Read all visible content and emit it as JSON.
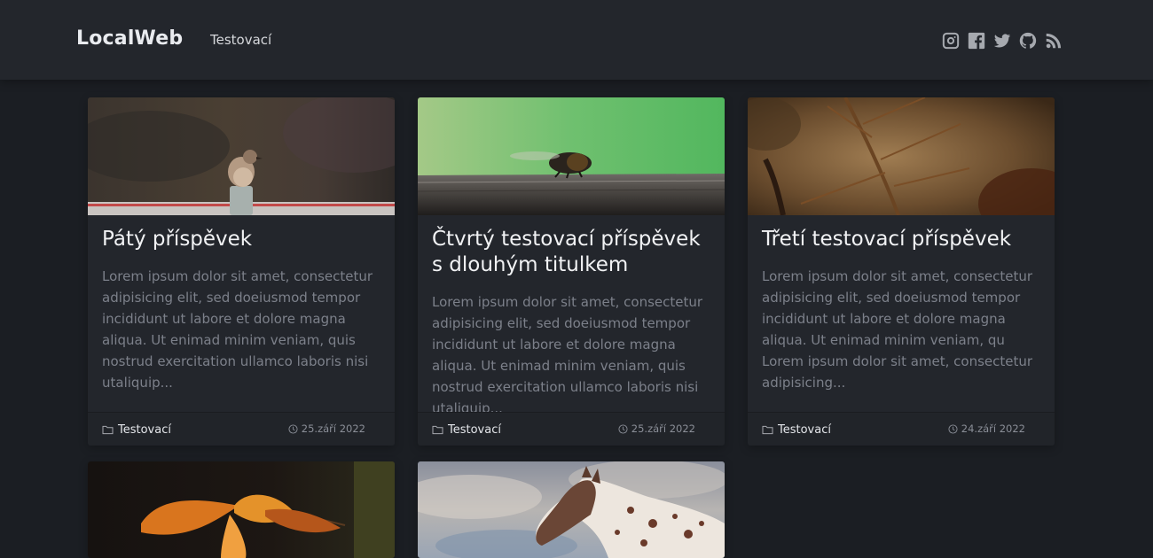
{
  "header": {
    "brand": "LocalWeb",
    "nav": [
      "Testovací"
    ],
    "social_icons": [
      "instagram-icon",
      "facebook-icon",
      "twitter-icon",
      "github-icon",
      "rss-icon"
    ]
  },
  "posts": [
    {
      "title": "Pátý příspěvek",
      "excerpt": "Lorem ipsum dolor sit amet, consectetur adipisicing elit, sed doeiusmod tempor incididunt ut labore et dolore magna aliqua. Ut enimad minim veniam, quis nostrud exercitation ullamco laboris nisi utaliquip...",
      "category": "Testovací",
      "date": "25.září 2022"
    },
    {
      "title": "Čtvrtý testovací příspěvek s dlouhým titulkem",
      "excerpt": "Lorem ipsum dolor sit amet, consectetur adipisicing elit, sed doeiusmod tempor incididunt ut labore et dolore magna aliqua. Ut enimad minim veniam, quis nostrud exercitation ullamco laboris nisi utaliquip...",
      "category": "Testovací",
      "date": "25.září 2022"
    },
    {
      "title": "Třetí testovací příspěvek",
      "excerpt": "Lorem ipsum dolor sit amet, consectetur adipisicing elit, sed doeiusmod tempor incididunt ut labore et dolore magna aliqua. Ut enimad minim veniam, qu Lorem ipsum dolor sit amet, consectetur adipisicing...",
      "category": "Testovací",
      "date": "24.září 2022"
    }
  ],
  "colors": {
    "background": "#1b1e23",
    "navbar": "#23262c",
    "card": "#23262c",
    "excerpt_text": "#7c808a"
  }
}
